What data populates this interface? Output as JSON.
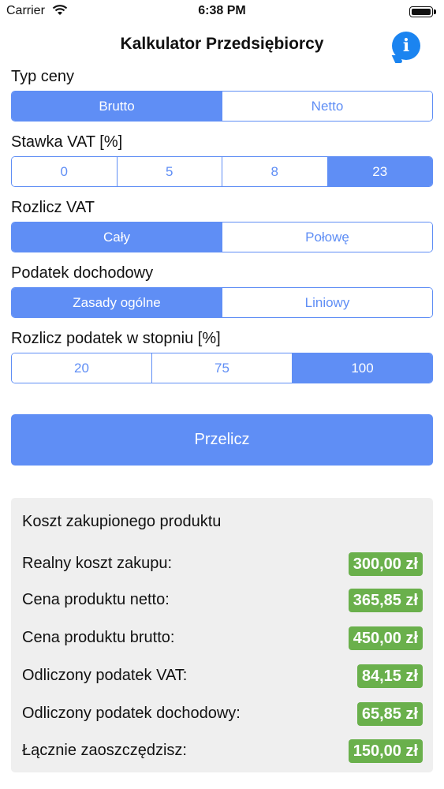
{
  "status_bar": {
    "carrier": "Carrier",
    "time": "6:38 PM"
  },
  "nav": {
    "title": "Kalkulator Przedsiębiorcy",
    "info_icon": "info-icon",
    "info_glyph": "i"
  },
  "colors": {
    "accent": "#5f8ef5",
    "value_badge": "#6ab04c",
    "info": "#1b84f0",
    "card_bg": "#efefef"
  },
  "sections": {
    "price_type": {
      "label": "Typ ceny",
      "options": [
        "Brutto",
        "Netto"
      ],
      "selected": "Brutto"
    },
    "vat_rate": {
      "label": "Stawka VAT [%]",
      "options": [
        "0",
        "5",
        "8",
        "23"
      ],
      "selected": "23"
    },
    "vat_settlement": {
      "label": "Rozlicz VAT",
      "options": [
        "Cały",
        "Połowę"
      ],
      "selected": "Cały"
    },
    "income_tax": {
      "label": "Podatek dochodowy",
      "options": [
        "Zasady ogólne",
        "Liniowy"
      ],
      "selected": "Zasady ogólne"
    },
    "tax_degree": {
      "label": "Rozlicz podatek w stopniu [%]",
      "options": [
        "20",
        "75",
        "100"
      ],
      "selected": "100"
    }
  },
  "calculate_button": "Przelicz",
  "results": {
    "title": "Koszt zakupionego produktu",
    "rows": [
      {
        "label": "Realny koszt zakupu:",
        "value": "300,00 zł"
      },
      {
        "label": "Cena produktu netto:",
        "value": "365,85 zł"
      },
      {
        "label": "Cena produktu brutto:",
        "value": "450,00 zł"
      },
      {
        "label": "Odliczony podatek VAT:",
        "value": "84,15 zł"
      },
      {
        "label": "Odliczony podatek dochodowy:",
        "value": "65,85 zł"
      },
      {
        "label": "Łącznie zaoszczędzisz:",
        "value": "150,00 zł"
      }
    ]
  }
}
